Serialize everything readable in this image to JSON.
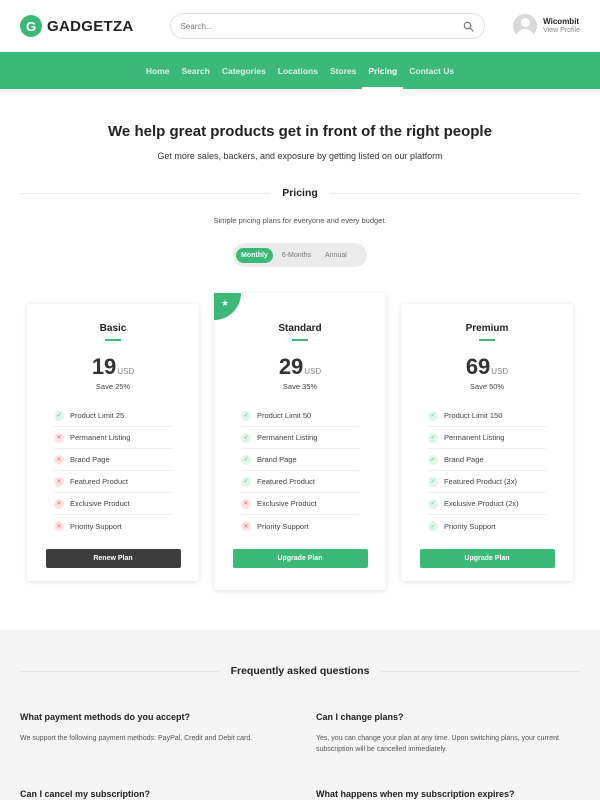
{
  "brand": {
    "logo_letter": "G",
    "name": "GADGETZA",
    "accent": "#3cb878"
  },
  "search": {
    "placeholder": "Search...",
    "icon": "search-icon"
  },
  "profile": {
    "name": "Wicombit",
    "link": "View Profile"
  },
  "nav": {
    "items": [
      {
        "label": "Home"
      },
      {
        "label": "Search"
      },
      {
        "label": "Categories"
      },
      {
        "label": "Locations"
      },
      {
        "label": "Stores"
      },
      {
        "label": "Pricing"
      },
      {
        "label": "Contact Us"
      }
    ],
    "active": "Pricing"
  },
  "hero": {
    "title": "We help great products get in front of the right people",
    "subtitle": "Get more sales, backers, and exposure by getting listed on our platform"
  },
  "pricing": {
    "heading": "Pricing",
    "subheading": "Simple pricing plans for everyone and every budget.",
    "billing_options": [
      "Monthly",
      "6-Months",
      "Annual"
    ],
    "billing_selected": "Monthly"
  },
  "plans": [
    {
      "name": "Basic",
      "price": "19",
      "currency": "USD",
      "save": "Save 25%",
      "features": [
        {
          "label": "Product Limit 25",
          "included": true
        },
        {
          "label": "Permanent Listing",
          "included": false
        },
        {
          "label": "Brand Page",
          "included": false
        },
        {
          "label": "Featured Product",
          "included": false
        },
        {
          "label": "Exclusive Product",
          "included": false
        },
        {
          "label": "Priority Support",
          "included": false
        }
      ],
      "button": "Renew Plan"
    },
    {
      "name": "Standard",
      "price": "29",
      "currency": "USD",
      "save": "Save 35%",
      "featured_icon": "star-icon",
      "features": [
        {
          "label": "Product Limit 50",
          "included": true
        },
        {
          "label": "Permanent Listing",
          "included": true
        },
        {
          "label": "Brand Page",
          "included": true
        },
        {
          "label": "Featured Product",
          "included": true
        },
        {
          "label": "Exclusive Product",
          "included": false
        },
        {
          "label": "Priority Support",
          "included": false
        }
      ],
      "button": "Upgrade Plan"
    },
    {
      "name": "Premium",
      "price": "69",
      "currency": "USD",
      "save": "Save 50%",
      "features": [
        {
          "label": "Product Limit 150",
          "included": true
        },
        {
          "label": "Permanent Listing",
          "included": true
        },
        {
          "label": "Brand Page",
          "included": true
        },
        {
          "label": "Featured Product (3x)",
          "included": true
        },
        {
          "label": "Exclusive Product (2x)",
          "included": true
        },
        {
          "label": "Priority Support",
          "included": true
        }
      ],
      "button": "Upgrade Plan"
    }
  ],
  "faq": {
    "heading": "Frequently asked questions",
    "items": [
      {
        "q": "What payment methods do you accept?",
        "a": "We support the following payment methods: PayPal, Credit and Debit card."
      },
      {
        "q": "Can I change plans?",
        "a": "Yes, you can change your plan at any time. Upon switching plans, your current subscription will be cancelled immediately."
      },
      {
        "q": "Can I cancel my subscription?",
        "a": ""
      },
      {
        "q": "What happens when my subscription expires?",
        "a": ""
      }
    ]
  }
}
